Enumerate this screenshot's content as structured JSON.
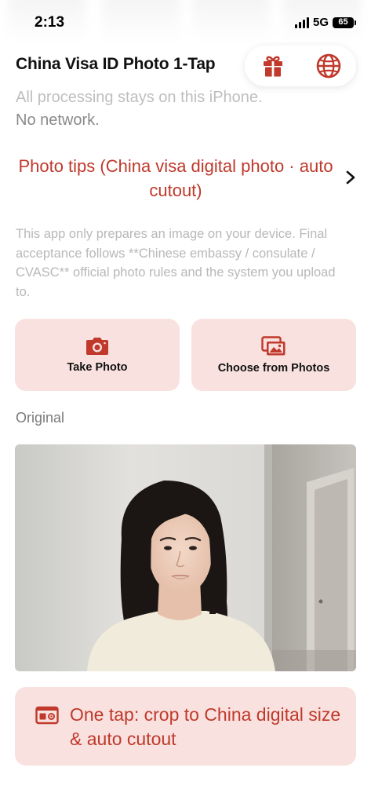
{
  "status_bar": {
    "time": "2:13",
    "network": "5G",
    "battery": "65"
  },
  "header": {
    "title": "China Visa ID Photo 1-Tap",
    "actions": [
      {
        "icon": "gift-icon"
      },
      {
        "icon": "globe-icon"
      }
    ]
  },
  "privacy": {
    "line1": "All processing stays on this iPhone.",
    "line2": "No network."
  },
  "tips": {
    "label": "Photo tips (China visa digital photo · auto cutout)"
  },
  "disclaimer": "This app only prepares an image on your device. Final acceptance follows **Chinese embassy / consulate / CVASC** official photo rules and the system you upload to.",
  "actions": {
    "take_photo": "Take Photo",
    "choose_photos": "Choose from Photos"
  },
  "original_label": "Original",
  "cutout_button": {
    "label": "One tap: crop to China digital size & auto cutout"
  },
  "colors": {
    "accent": "#c0392b",
    "button_bg": "#f8e1df",
    "muted_text": "#8a8a8a",
    "disclaimer_text": "#b8b8b8"
  }
}
